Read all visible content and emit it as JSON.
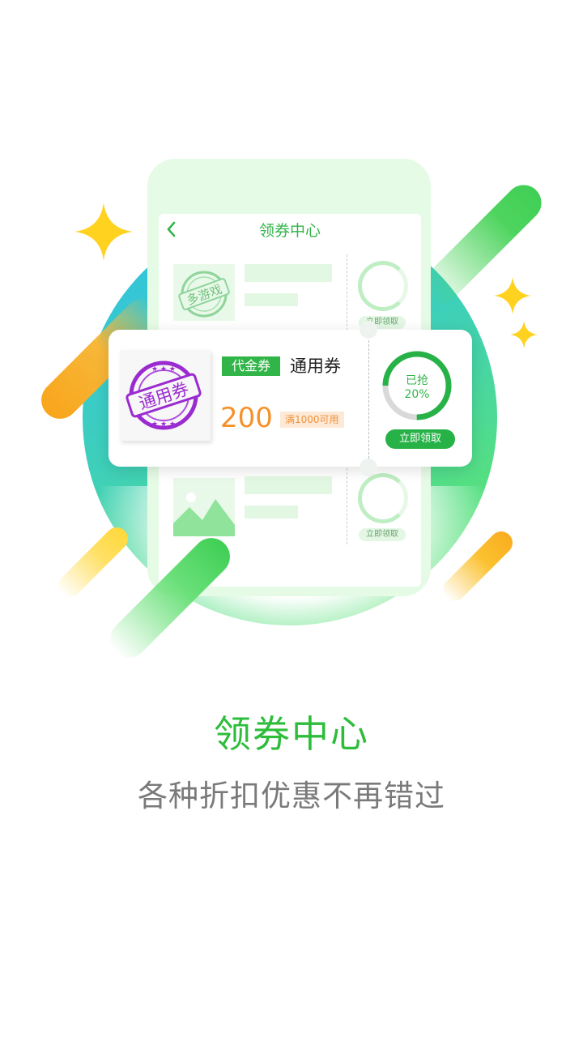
{
  "screen": {
    "title": "领券中心",
    "back_icon": "chevron-left-icon",
    "ghost_coupons": [
      {
        "stamp_text": "多游戏",
        "button_label": "立即领取"
      },
      {
        "button_label": "立即领取"
      }
    ]
  },
  "coupon": {
    "stamp_text": "通用券",
    "tag": "代金券",
    "name": "通用券",
    "amount": "200",
    "condition": "满1000可用",
    "progress_label": "已抢",
    "progress_text": "20%",
    "progress_fraction": 0.2,
    "claim_label": "立即领取"
  },
  "headline": "领券中心",
  "subheadline": "各种折扣优惠不再错过",
  "colors": {
    "brand_green": "#31b448",
    "amount_orange": "#f5922b",
    "stamp_purple": "#9b2bd0",
    "sparkle_yellow": "#ffd21f"
  }
}
